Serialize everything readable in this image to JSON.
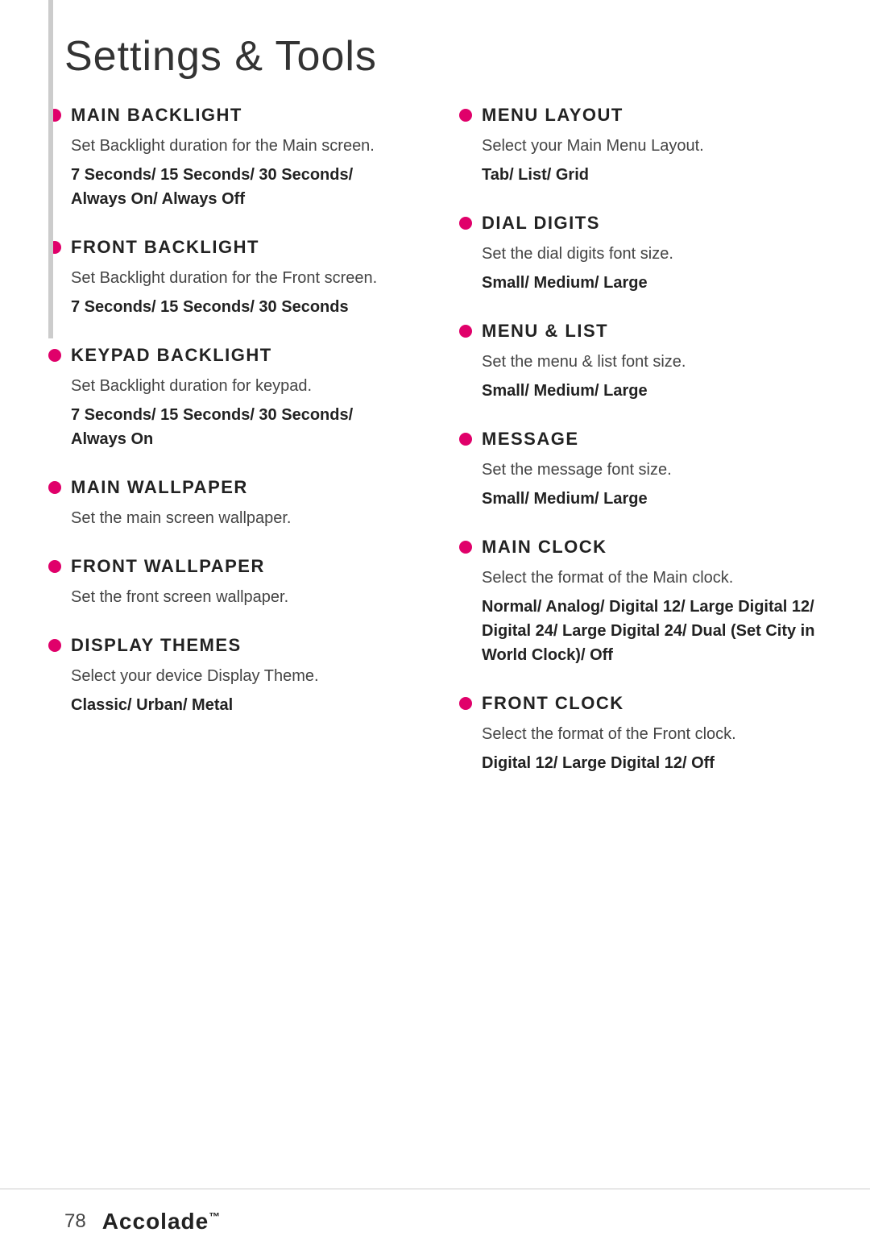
{
  "page": {
    "title": "Settings & Tools",
    "page_number": "78",
    "brand": "Accolade",
    "brand_tm": "™"
  },
  "left_column": {
    "sections": [
      {
        "id": "main-backlight",
        "heading": "MAIN BACKLIGHT",
        "description": "Set Backlight duration for the Main screen.",
        "options": "7 Seconds/ 15 Seconds/ 30 Seconds/ Always On/ Always Off"
      },
      {
        "id": "front-backlight",
        "heading": "FRONT BACKLIGHT",
        "description": "Set Backlight duration for the Front screen.",
        "options": "7 Seconds/ 15 Seconds/ 30 Seconds"
      },
      {
        "id": "keypad-backlight",
        "heading": "KEYPAD BACKLIGHT",
        "description": "Set Backlight duration for keypad.",
        "options": "7 Seconds/ 15 Seconds/ 30 Seconds/ Always On"
      },
      {
        "id": "main-wallpaper",
        "heading": "MAIN WALLPAPER",
        "description": "Set the main screen wallpaper.",
        "options": ""
      },
      {
        "id": "front-wallpaper",
        "heading": "FRONT WALLPAPER",
        "description": "Set the front screen wallpaper.",
        "options": ""
      },
      {
        "id": "display-themes",
        "heading": "DISPLAY THEMES",
        "description": "Select your device Display Theme.",
        "options": "Classic/ Urban/ Metal"
      }
    ]
  },
  "right_column": {
    "sections": [
      {
        "id": "menu-layout",
        "heading": "MENU LAYOUT",
        "description": "Select your Main Menu Layout.",
        "options": "Tab/ List/ Grid"
      },
      {
        "id": "dial-digits",
        "heading": "DIAL DIGITS",
        "description": "Set the dial digits font size.",
        "options": "Small/ Medium/ Large"
      },
      {
        "id": "menu-list",
        "heading": "MENU & LIST",
        "description": "Set the menu & list font size.",
        "options": "Small/ Medium/ Large"
      },
      {
        "id": "message",
        "heading": "MESSAGE",
        "description": "Set the message font size.",
        "options": "Small/ Medium/ Large"
      },
      {
        "id": "main-clock",
        "heading": "MAIN CLOCK",
        "description": "Select the format of the Main clock.",
        "options": "Normal/ Analog/ Digital 12/ Large Digital 12/ Digital 24/ Large Digital 24/ Dual (Set City in World Clock)/ Off"
      },
      {
        "id": "front-clock",
        "heading": "FRONT CLOCK",
        "description": "Select the format of the Front clock.",
        "options": "Digital 12/ Large Digital 12/ Off"
      }
    ]
  }
}
